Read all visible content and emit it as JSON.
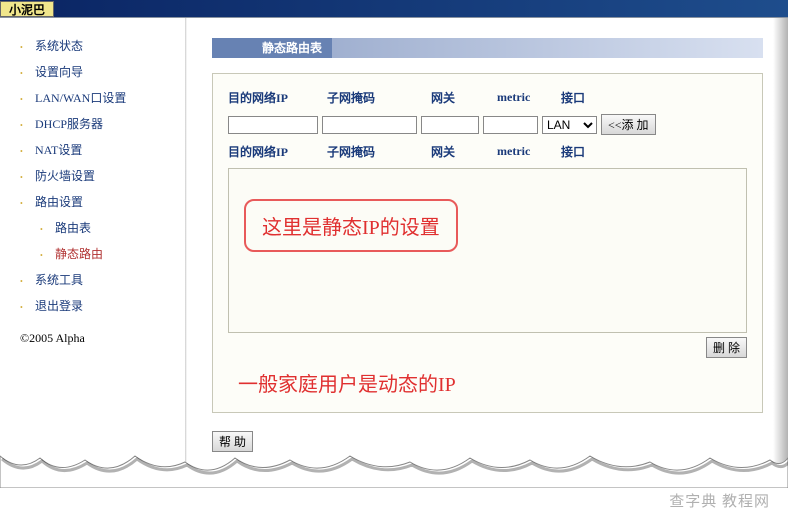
{
  "app_title": "小泥巴",
  "sidebar": {
    "items": [
      {
        "label": "系统状态"
      },
      {
        "label": "设置向导"
      },
      {
        "label": "LAN/WAN口设置"
      },
      {
        "label": "DHCP服务器"
      },
      {
        "label": "NAT设置"
      },
      {
        "label": "防火墙设置"
      },
      {
        "label": "路由设置"
      },
      {
        "label": "系统工具"
      },
      {
        "label": "退出登录"
      }
    ],
    "sub_items": [
      {
        "label": "路由表"
      },
      {
        "label": "静态路由"
      }
    ],
    "copyright": "©2005 Alpha"
  },
  "page": {
    "title": "静态路由表",
    "columns": {
      "dest_ip": "目的网络IP",
      "netmask": "子网掩码",
      "gateway": "网关",
      "metric": "metric",
      "interface": "接口"
    },
    "interface_selected": "LAN",
    "add_button": "<<添 加",
    "delete_button": "删 除",
    "help_button": "帮 助",
    "inputs": {
      "dest_ip": "",
      "netmask": "",
      "gateway": "",
      "metric": ""
    }
  },
  "annotations": {
    "box_text": "这里是静态IP的设置",
    "bottom_text": "一般家庭用户是动态的IP"
  },
  "watermark": "查字典 教程网"
}
